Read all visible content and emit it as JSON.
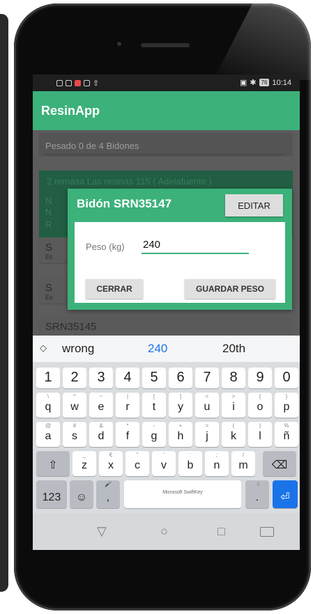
{
  "statusbar": {
    "battery": "76",
    "time": "10:14"
  },
  "app": {
    "title": "ResinApp"
  },
  "progress": {
    "label": "Pesado 0 de 4 Bidones",
    "fraction": 0
  },
  "card": {
    "title": "2 remasa Las resinas 115 ( Adelafuente )",
    "line1": "N",
    "line2": "N",
    "line3": "R"
  },
  "list": [
    {
      "letter": "S",
      "sub": "Es"
    },
    {
      "letter": "S",
      "sub": "Es"
    },
    {
      "letter": "SRN35145",
      "sub": ""
    }
  ],
  "dialog": {
    "title": "Bidón SRN35147",
    "edit_label": "EDITAR",
    "peso_label": "Peso (kg)",
    "peso_value": "240",
    "close_label": "CERRAR",
    "save_label": "GUARDAR PESO"
  },
  "keyboard": {
    "suggestions": [
      "wrong",
      "240",
      "20th"
    ],
    "number_row": [
      "1",
      "2",
      "3",
      "4",
      "5",
      "6",
      "7",
      "8",
      "9",
      "0"
    ],
    "row1": [
      {
        "k": "q",
        "h": "\\"
      },
      {
        "k": "w",
        "h": "^"
      },
      {
        "k": "e",
        "h": "~"
      },
      {
        "k": "r",
        "h": "|"
      },
      {
        "k": "t",
        "h": "["
      },
      {
        "k": "y",
        "h": "]"
      },
      {
        "k": "u",
        "h": "<"
      },
      {
        "k": "i",
        "h": ">"
      },
      {
        "k": "o",
        "h": "{"
      },
      {
        "k": "p",
        "h": "}"
      }
    ],
    "row2": [
      {
        "k": "a",
        "h": "@"
      },
      {
        "k": "s",
        "h": "#"
      },
      {
        "k": "d",
        "h": "&"
      },
      {
        "k": "f",
        "h": "*"
      },
      {
        "k": "g",
        "h": "-"
      },
      {
        "k": "h",
        "h": "+"
      },
      {
        "k": "j",
        "h": "="
      },
      {
        "k": "k",
        "h": "("
      },
      {
        "k": "l",
        "h": ")"
      },
      {
        "k": "ñ",
        "h": "%"
      }
    ],
    "row3": [
      {
        "k": "z",
        "h": "_"
      },
      {
        "k": "x",
        "h": "€"
      },
      {
        "k": "c",
        "h": "\""
      },
      {
        "k": "v",
        "h": "'"
      },
      {
        "k": "b",
        "h": ":"
      },
      {
        "k": "n",
        "h": ";"
      },
      {
        "k": "m",
        "h": "/"
      }
    ],
    "symbols_label": "123",
    "emoji_label": "☺",
    "comma_label": ",",
    "period_label": ".",
    "space_brand": "Microsoft SwiftKey"
  }
}
